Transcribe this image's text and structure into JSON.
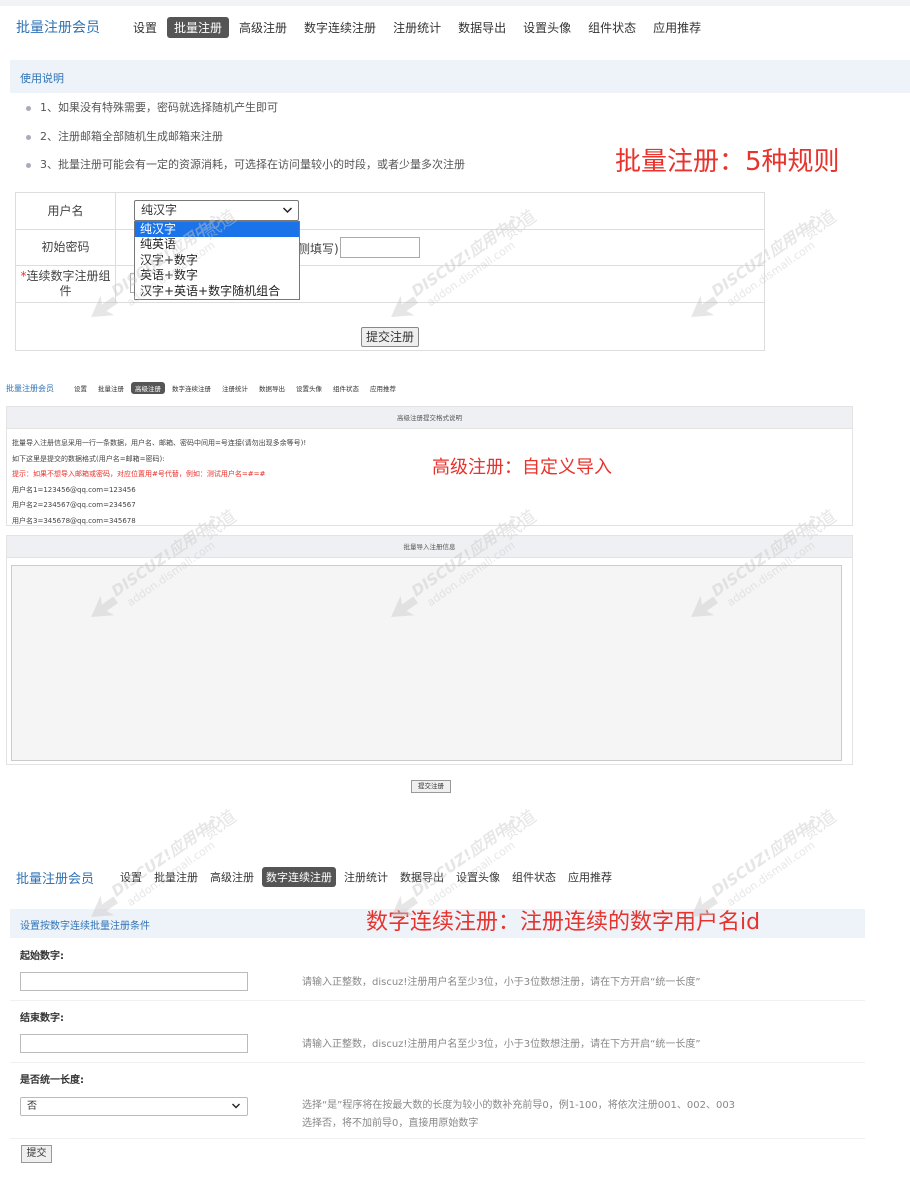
{
  "nav_items": [
    "设置",
    "批量注册",
    "高级注册",
    "数字连续注册",
    "注册统计",
    "数据导出",
    "设置头像",
    "组件状态",
    "应用推荐"
  ],
  "section1": {
    "brand": "批量注册会员",
    "active_tab": "批量注册",
    "notice_title": "使用说明",
    "tips": [
      "1、如果没有特殊需要，密码就选择随机产生即可",
      "2、注册邮箱全部随机生成邮箱来注册",
      "3、批量注册可能会有一定的资源消耗，可选择在访问量较小的时段，或者少量多次注册"
    ],
    "caption": "批量注册：5种规则",
    "form": {
      "username_label": "用户名",
      "username_selected": "纯汉字",
      "username_options": [
        "纯汉字",
        "纯英语",
        "汉字+数字",
        "英语+数字",
        "汉字+英语+数字随机组合"
      ],
      "password_label": "初始密码",
      "password_suffix": "侧填写)",
      "sequence_label_required": "*",
      "sequence_label": "连续数字注册组件",
      "submit": "提交注册"
    }
  },
  "section2": {
    "brand": "批量注册会员",
    "active_tab": "高级注册",
    "caption": "高级注册：自定义导入",
    "format_title": "高级注册提交格式说明",
    "format_lines": [
      "批量导入注册信息采用一行一条数据，用户名、邮箱、密码中间用=号连接(请勿出现多余等号)!",
      "如下这里是提交的数据格式(用户名=邮箱=密码):"
    ],
    "format_tip": "提示：如果不想导入邮箱或密码，对应位置用#号代替，例如：测试用户名=#=#",
    "examples": [
      "用户名1=123456@qq.com=123456",
      "用户名2=234567@qq.com=234567",
      "用户名3=345678@qq.com=345678"
    ],
    "import_title": "批量导入注册信息",
    "submit": "提交注册"
  },
  "section3": {
    "brand": "批量注册会员",
    "active_tab": "数字连续注册",
    "caption": "数字连续注册：注册连续的数字用户名id",
    "condition_title": "设置按数字连续批量注册条件",
    "start_label": "起始数字:",
    "end_label": "结束数字:",
    "hint": "请输入正整数，discuz!注册用户名至少3位，小于3位数想注册，请在下方开启“统一长度”",
    "uniform_label": "是否统一长度:",
    "uniform_value": "否",
    "uniform_hint_1": "选择“是”程序将在按最大数的长度为较小的数补充前导0，例1-100，将依次注册001、002、003",
    "uniform_hint_2": "选择否，将不加前导0，直接用原始数字",
    "submit": "提交"
  },
  "watermark": {
    "line1": "DISCUZ!应用中心",
    "line2": "addon.dismall.com",
    "sig": "贰道"
  },
  "colors": {
    "brand": "#2f73b5",
    "caption_red": "#e8322c",
    "active_tab": "#555555",
    "dropdown_highlight": "#1a73e8"
  }
}
